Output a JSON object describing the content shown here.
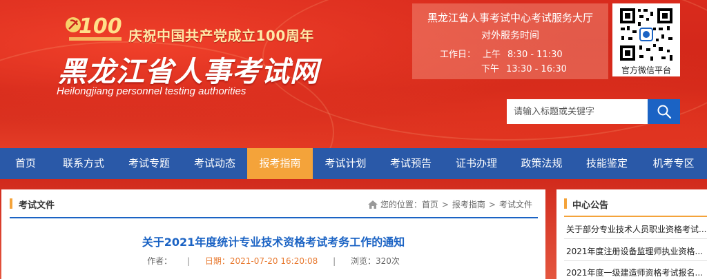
{
  "header": {
    "anniversary_text": "庆祝中国共产党成立100周年",
    "logo_number": "100",
    "site_title": "黑龙江省人事考试网",
    "site_subtitle": "Heilongjiang personnel testing authorities",
    "service": {
      "title": "黑龙江省人事考试中心考试服务大厅",
      "subtitle": "对外服务时间",
      "workday_label": "工作日：",
      "am_label": "上午",
      "am_time": "8:30 - 11:30",
      "pm_label": "下午",
      "pm_time": "13:30 - 16:30"
    },
    "qr_label": "官方微信平台",
    "search": {
      "placeholder": "请输入标题或关键字",
      "icon": "search-icon"
    }
  },
  "nav": {
    "items": [
      {
        "label": "首页"
      },
      {
        "label": "联系方式"
      },
      {
        "label": "考试专题"
      },
      {
        "label": "考试动态"
      },
      {
        "label": "报考指南"
      },
      {
        "label": "考试计划"
      },
      {
        "label": "考试预告"
      },
      {
        "label": "证书办理"
      },
      {
        "label": "政策法规"
      },
      {
        "label": "技能鉴定"
      },
      {
        "label": "机考专区"
      }
    ],
    "active_label": "报考指南"
  },
  "main": {
    "section_title": "考试文件",
    "breadcrumb": {
      "prefix": "您的位置：",
      "items": [
        "首页",
        "报考指南",
        "考试文件"
      ],
      "separator": ">"
    },
    "article": {
      "title": "关于2021年度统计专业技术资格考试考务工作的通知",
      "author_label": "作者：",
      "date_text": "日期：2021-07-20 16:20:08",
      "views_text": "浏览：320次",
      "separator": "|"
    }
  },
  "sidebar": {
    "title": "中心公告",
    "notices": [
      "关于部分专业技术人员职业资格考试...",
      "2021年度注册设备监理师执业资格...",
      "2021年度一级建造师资格考试报名..."
    ]
  },
  "colors": {
    "banner_red": "#d92b1d",
    "nav_blue": "#2a59a8",
    "nav_active": "#f4a33a",
    "link_blue": "#1b63c4",
    "date_orange": "#e8792f"
  }
}
